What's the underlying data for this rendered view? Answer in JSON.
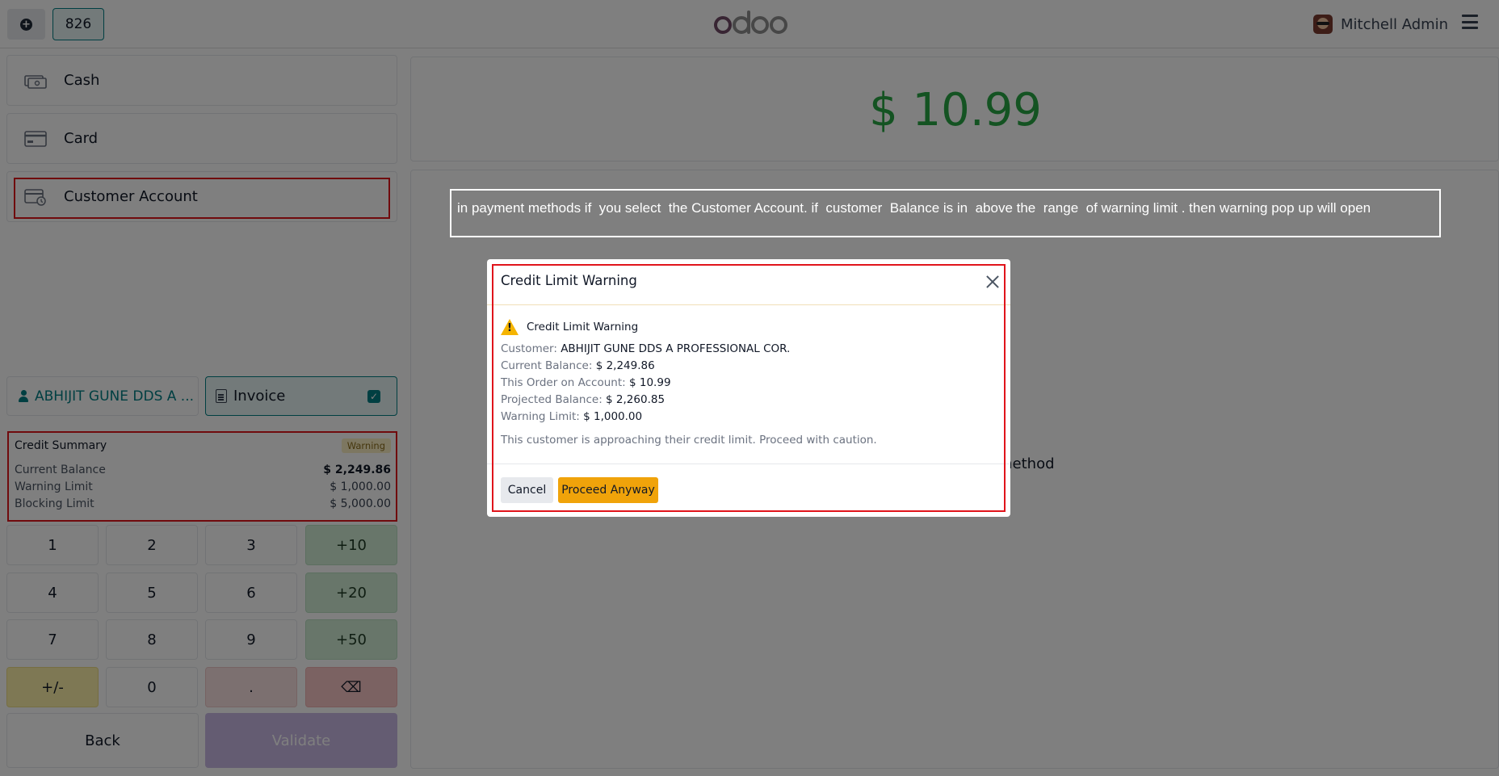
{
  "topbar": {
    "order_number": "826",
    "brand": "odoo",
    "user_name": "Mitchell Admin"
  },
  "payment_methods": [
    {
      "label": "Cash",
      "icon": "cash-icon"
    },
    {
      "label": "Card",
      "icon": "card-icon"
    },
    {
      "label": "Customer Account",
      "icon": "customer-account-icon"
    }
  ],
  "customer": {
    "name": "ABHIJIT GUNE DDS A ...",
    "icon": "person-icon"
  },
  "invoice": {
    "label": "Invoice",
    "checked": true
  },
  "credit_summary": {
    "title": "Credit Summary",
    "badge": "Warning",
    "rows": [
      {
        "label": "Current Balance",
        "value": "$ 2,249.86"
      },
      {
        "label": "Warning Limit",
        "value": "$ 1,000.00"
      },
      {
        "label": "Blocking Limit",
        "value": "$ 5,000.00"
      }
    ]
  },
  "numpad": {
    "keys": [
      "1",
      "2",
      "3",
      "+10",
      "4",
      "5",
      "6",
      "+20",
      "7",
      "8",
      "9",
      "+50",
      "+/-",
      "0",
      ".",
      "⌫"
    ]
  },
  "actions": {
    "back": "Back",
    "validate": "Validate"
  },
  "payment": {
    "amount": "$ 10.99",
    "background_text": "method"
  },
  "annotation": "in payment methods if  you select  the Customer Account. if  customer  Balance is in  above the  range  of warning limit . then warning pop up will open",
  "modal": {
    "title": "Credit Limit Warning",
    "heading": "Credit Limit Warning",
    "details": [
      {
        "label": "Customer:",
        "value": "ABHIJIT GUNE DDS A PROFESSIONAL COR."
      },
      {
        "label": "Current Balance:",
        "value": "$ 2,249.86"
      },
      {
        "label": "This Order on Account:",
        "value": "$ 10.99"
      },
      {
        "label": "Projected Balance:",
        "value": "$ 2,260.85"
      },
      {
        "label": "Warning Limit:",
        "value": "$ 1,000.00"
      }
    ],
    "message": "This customer is approaching their credit limit. Proceed with caution.",
    "cancel": "Cancel",
    "proceed": "Proceed Anyway"
  },
  "colors": {
    "accent": "#017e84",
    "amount": "#28a745",
    "highlight_border": "#e0141b",
    "proceed": "#f0a30a",
    "warning_badge_bg": "#fbeec3"
  }
}
